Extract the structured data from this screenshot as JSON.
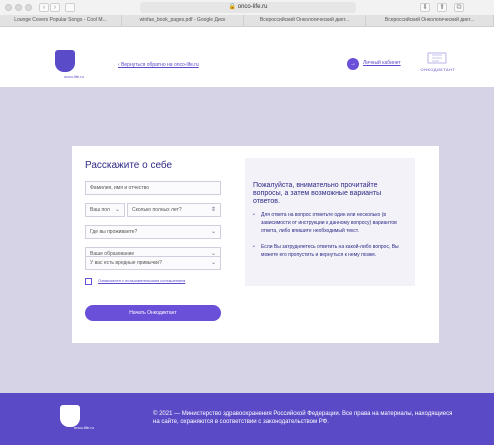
{
  "browser": {
    "url": "onco-life.ru",
    "tabs": [
      "Lounge Covers Popular Songs - Cool M...",
      "winfae_book_pages.pdf - Google Диск",
      "Всероссийский Онкологический дикт...",
      "Всероссийский Онкологический дикт..."
    ]
  },
  "header": {
    "logo_caption": "onco-life.ru",
    "back_link": "Вернуться обратно на onco-life.ru",
    "cabinet_link": "Личный кабинет",
    "brand_name": "ОНКОДИКТАНТ"
  },
  "form": {
    "title": "Расскажите о себе",
    "name_placeholder": "Фамилия, имя и отчество",
    "gender_placeholder": "Ваш пол",
    "age_placeholder": "Сколько полных лет?",
    "residence_placeholder": "Где вы проживаете?",
    "education_placeholder": "Ваше образование",
    "habits_placeholder": "У вас есть вредные привычки?",
    "agree_text": "Ознакомлен с пользовательским соглашением",
    "submit_label": "Начать Онкодиктант"
  },
  "hint": {
    "title": "Пожалуйста, внимательно прочитайте вопросы, а затем возможные варианты ответов.",
    "bullets": [
      "Для ответа на вопрос отметьте один или несколько (в зависимости от инструкции к данному вопросу) вариантов ответа, либо впишите необходимый текст.",
      "Если Вы затрудняетесь ответить на какой-либо вопрос, Вы можете его пропустить и вернуться к нему позже."
    ]
  },
  "footer": {
    "text": "© 2021 — Министерство здравоохранения Российской Федерации. Все права на материалы, находящиеся на сайте, охраняются в соответствии с законодательством РФ.",
    "logo_caption": "onco-life.ru"
  },
  "colors": {
    "accent": "#6a4fd8",
    "deep": "#2f2a86",
    "band": "#d6d3e6",
    "footer": "#5b4ac6"
  }
}
